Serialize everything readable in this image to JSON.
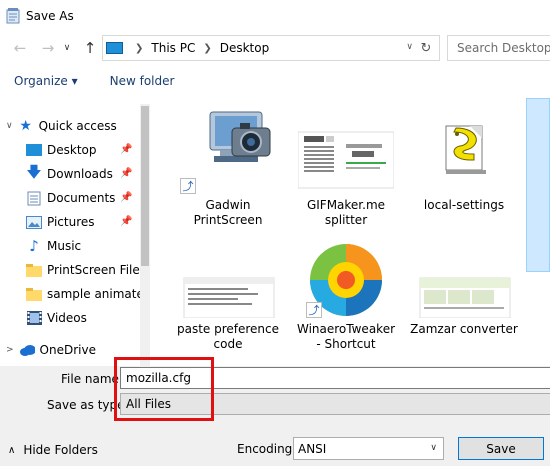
{
  "window": {
    "title": "Save As"
  },
  "nav": {
    "back_icon": "arrow-left-icon",
    "forward_icon": "arrow-right-icon",
    "recent_icon": "chevron-down-icon",
    "up_icon": "arrow-up-icon",
    "breadcrumbs": [
      "This PC",
      "Desktop"
    ],
    "search_placeholder": "Search Desktop"
  },
  "toolbar": {
    "organize_label": "Organize ▾",
    "new_folder_label": "New folder"
  },
  "sidebar": {
    "items": [
      {
        "label": "Quick access",
        "icon": "star-icon",
        "pinned": false
      },
      {
        "label": "Desktop",
        "icon": "desktop-folder-icon",
        "pinned": true
      },
      {
        "label": "Downloads",
        "icon": "download-icon",
        "pinned": true
      },
      {
        "label": "Documents",
        "icon": "documents-icon",
        "pinned": true
      },
      {
        "label": "Pictures",
        "icon": "pictures-icon",
        "pinned": true
      },
      {
        "label": "Music",
        "icon": "music-icon",
        "pinned": false
      },
      {
        "label": "PrintScreen Files",
        "icon": "folder-icon",
        "pinned": false
      },
      {
        "label": "sample animated",
        "icon": "folder-icon",
        "pinned": false
      },
      {
        "label": "Videos",
        "icon": "videos-icon",
        "pinned": false
      },
      {
        "label": "OneDrive",
        "icon": "cloud-icon",
        "pinned": false
      }
    ]
  },
  "files": [
    {
      "label_line1": "Gadwin",
      "label_line2": "PrintScreen",
      "icon": "camera-app-icon",
      "shortcut": true
    },
    {
      "label_line1": "GIFMaker.me",
      "label_line2": "splitter",
      "icon": "webpage-thumbnail-icon",
      "shortcut": false
    },
    {
      "label_line1": "local-settings",
      "label_line2": "",
      "icon": "script-file-icon",
      "shortcut": false
    },
    {
      "label_line1": "paste preference",
      "label_line2": "code",
      "icon": "text-thumbnail-icon",
      "shortcut": false
    },
    {
      "label_line1": "WinaeroTweaker",
      "label_line2": "- Shortcut",
      "icon": "winaero-logo-icon",
      "shortcut": true
    },
    {
      "label_line1": "Zamzar converter",
      "label_line2": "",
      "icon": "webpage-thumbnail-icon",
      "shortcut": false
    }
  ],
  "form": {
    "file_name_label": "File name:",
    "file_name_value": "mozilla.cfg",
    "save_as_type_label": "Save as type:",
    "save_as_type_value": "All Files",
    "hide_folders_label": "Hide Folders",
    "encoding_label": "Encoding:",
    "encoding_value": "ANSI",
    "save_label": "Save"
  },
  "colors": {
    "accent": "#0078d7",
    "highlight_box": "#e01010",
    "link": "#1a3e72"
  }
}
